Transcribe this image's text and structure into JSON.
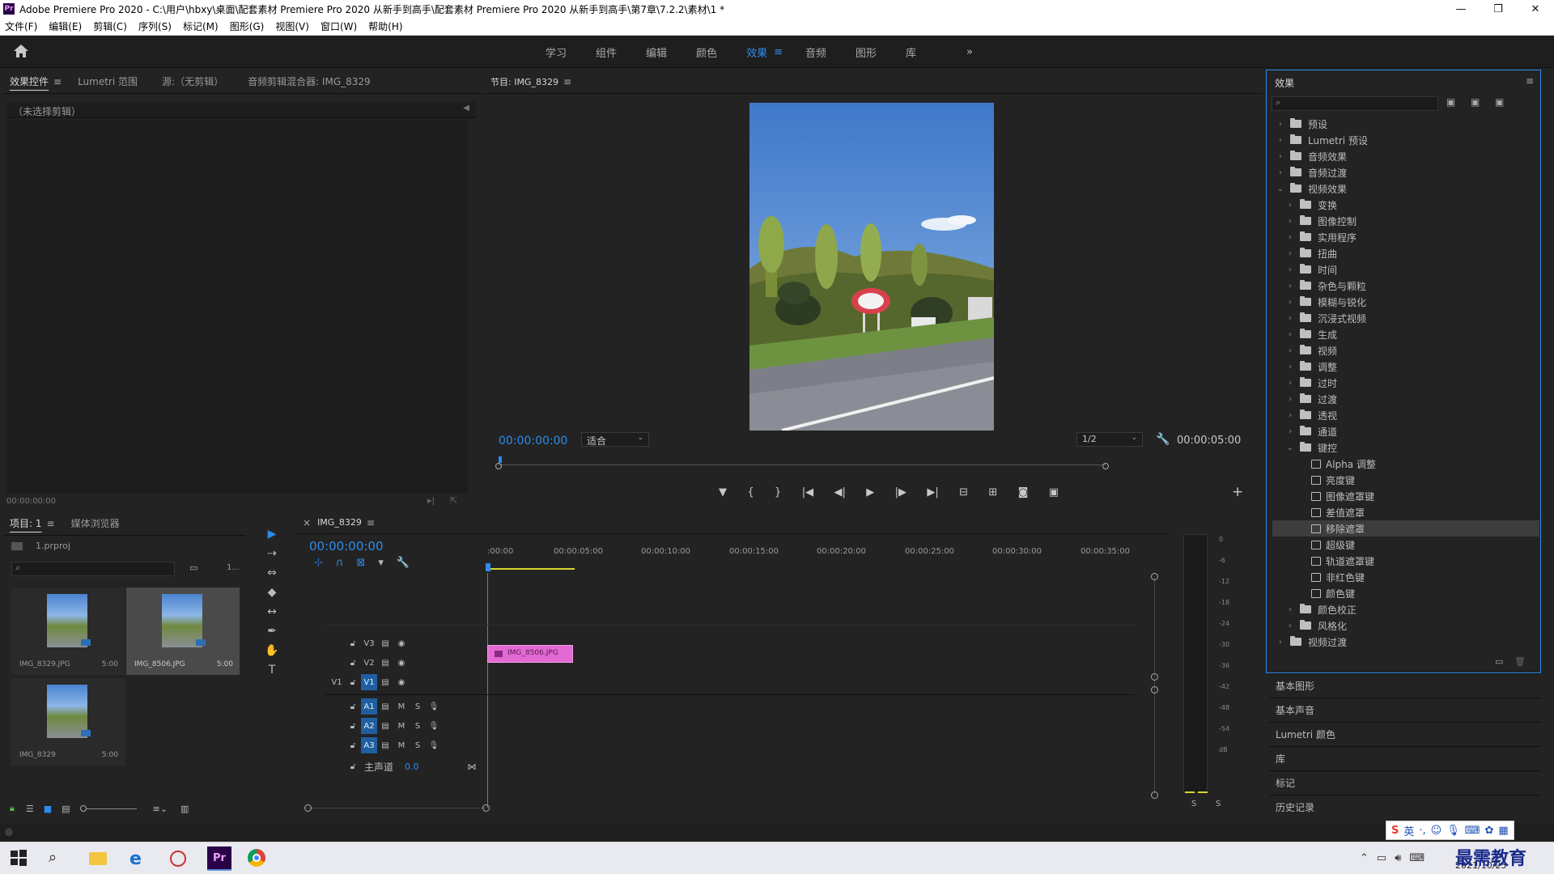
{
  "window": {
    "title": "Adobe Premiere Pro 2020 - C:\\用户\\hbxy\\桌面\\配套素材 Premiere Pro 2020 从新手到高手\\配套素材 Premiere Pro 2020 从新手到高手\\第7章\\7.2.2\\素材\\1 *",
    "app_icon": "Pr"
  },
  "menu": [
    "文件(F)",
    "编辑(E)",
    "剪辑(C)",
    "序列(S)",
    "标记(M)",
    "图形(G)",
    "视图(V)",
    "窗口(W)",
    "帮助(H)"
  ],
  "workspaces": {
    "items": [
      "学习",
      "组件",
      "编辑",
      "颜色",
      "效果",
      "音频",
      "图形",
      "库"
    ],
    "active": "效果",
    "menu_glyph": "≡",
    "more": "»"
  },
  "source_panel": {
    "tabs": [
      "效果控件",
      "Lumetri 范围",
      "源:（无剪辑）",
      "音频剪辑混合器: IMG_8329"
    ],
    "active_tab": "效果控件",
    "no_clip": "（未选择剪辑）",
    "timecode": "00:00:00:00"
  },
  "program": {
    "title": "节目: IMG_8329",
    "timecode_left": "00:00:00:00",
    "fit": "适合",
    "resolution": "1/2",
    "timecode_right": "00:00:05:00"
  },
  "project": {
    "tabs": [
      "项目: 1",
      "媒体浏览器"
    ],
    "file": "1.prproj",
    "count": "1...",
    "items": [
      {
        "name": "IMG_8329.JPG",
        "duration": "5:00"
      },
      {
        "name": "IMG_8506.JPG",
        "duration": "5:00"
      },
      {
        "name": "IMG_8329",
        "duration": "5:00"
      }
    ]
  },
  "timeline": {
    "tab": "IMG_8329",
    "close": "×",
    "timecode": "00:00:00:00",
    "ruler": [
      ":00:00",
      "00:00:05:00",
      "00:00:10:00",
      "00:00:15:00",
      "00:00:20:00",
      "00:00:25:00",
      "00:00:30:00",
      "00:00:35:00"
    ],
    "tracks": [
      {
        "id": "V3",
        "type": "video"
      },
      {
        "id": "V2",
        "type": "video"
      },
      {
        "id": "V1",
        "type": "video",
        "source": "V1"
      },
      {
        "id": "A1",
        "type": "audio"
      },
      {
        "id": "A2",
        "type": "audio"
      },
      {
        "id": "A3",
        "type": "audio"
      }
    ],
    "master": {
      "label": "主声道",
      "value": "0.0"
    },
    "mute": "M",
    "solo": "S",
    "clip": {
      "name": "IMG_8506.JPG",
      "track": "V2",
      "color": "#e46ad3"
    }
  },
  "meter": {
    "ticks": [
      "0",
      "-6",
      "-12",
      "-18",
      "-24",
      "-30",
      "-36",
      "-42",
      "-48",
      "-54",
      "dB"
    ],
    "buttons": [
      "S",
      "S"
    ]
  },
  "effects": {
    "title": "效果",
    "tree": [
      {
        "label": "预设",
        "level": 0,
        "kind": "folder",
        "open": false
      },
      {
        "label": "Lumetri 预设",
        "level": 0,
        "kind": "folder",
        "open": false
      },
      {
        "label": "音频效果",
        "level": 0,
        "kind": "folder",
        "open": false
      },
      {
        "label": "音频过渡",
        "level": 0,
        "kind": "folder",
        "open": false
      },
      {
        "label": "视频效果",
        "level": 0,
        "kind": "folder",
        "open": true
      },
      {
        "label": "变换",
        "level": 1,
        "kind": "folder",
        "open": false
      },
      {
        "label": "图像控制",
        "level": 1,
        "kind": "folder",
        "open": false
      },
      {
        "label": "实用程序",
        "level": 1,
        "kind": "folder",
        "open": false
      },
      {
        "label": "扭曲",
        "level": 1,
        "kind": "folder",
        "open": false
      },
      {
        "label": "时间",
        "level": 1,
        "kind": "folder",
        "open": false
      },
      {
        "label": "杂色与颗粒",
        "level": 1,
        "kind": "folder",
        "open": false
      },
      {
        "label": "模糊与锐化",
        "level": 1,
        "kind": "folder",
        "open": false
      },
      {
        "label": "沉浸式视频",
        "level": 1,
        "kind": "folder",
        "open": false
      },
      {
        "label": "生成",
        "level": 1,
        "kind": "folder",
        "open": false
      },
      {
        "label": "视频",
        "level": 1,
        "kind": "folder",
        "open": false
      },
      {
        "label": "调整",
        "level": 1,
        "kind": "folder",
        "open": false
      },
      {
        "label": "过时",
        "level": 1,
        "kind": "folder",
        "open": false
      },
      {
        "label": "过渡",
        "level": 1,
        "kind": "folder",
        "open": false
      },
      {
        "label": "透视",
        "level": 1,
        "kind": "folder",
        "open": false
      },
      {
        "label": "通道",
        "level": 1,
        "kind": "folder",
        "open": false
      },
      {
        "label": "键控",
        "level": 1,
        "kind": "folder",
        "open": true
      },
      {
        "label": "Alpha 调整",
        "level": 2,
        "kind": "effect"
      },
      {
        "label": "亮度键",
        "level": 2,
        "kind": "effect"
      },
      {
        "label": "图像遮罩键",
        "level": 2,
        "kind": "effect"
      },
      {
        "label": "差值遮罩",
        "level": 2,
        "kind": "effect"
      },
      {
        "label": "移除遮罩",
        "level": 2,
        "kind": "effect",
        "selected": true
      },
      {
        "label": "超级键",
        "level": 2,
        "kind": "effect"
      },
      {
        "label": "轨道遮罩键",
        "level": 2,
        "kind": "effect"
      },
      {
        "label": "非红色键",
        "level": 2,
        "kind": "effect"
      },
      {
        "label": "颜色键",
        "level": 2,
        "kind": "effect"
      },
      {
        "label": "颜色校正",
        "level": 1,
        "kind": "folder",
        "open": false
      },
      {
        "label": "风格化",
        "level": 1,
        "kind": "folder",
        "open": false
      },
      {
        "label": "视频过渡",
        "level": 0,
        "kind": "folder",
        "open": false
      }
    ]
  },
  "lower_panels": [
    "基本图形",
    "基本声音",
    "Lumetri 颜色",
    "库",
    "标记",
    "历史记录"
  ],
  "taskbar": {
    "ime": "英",
    "date": "2021/10/25",
    "watermark": "最需教育"
  },
  "colors": {
    "accent": "#2d8ceb",
    "clip": "#e46ad3",
    "panel": "#232323",
    "dark": "#1b1b1b"
  }
}
